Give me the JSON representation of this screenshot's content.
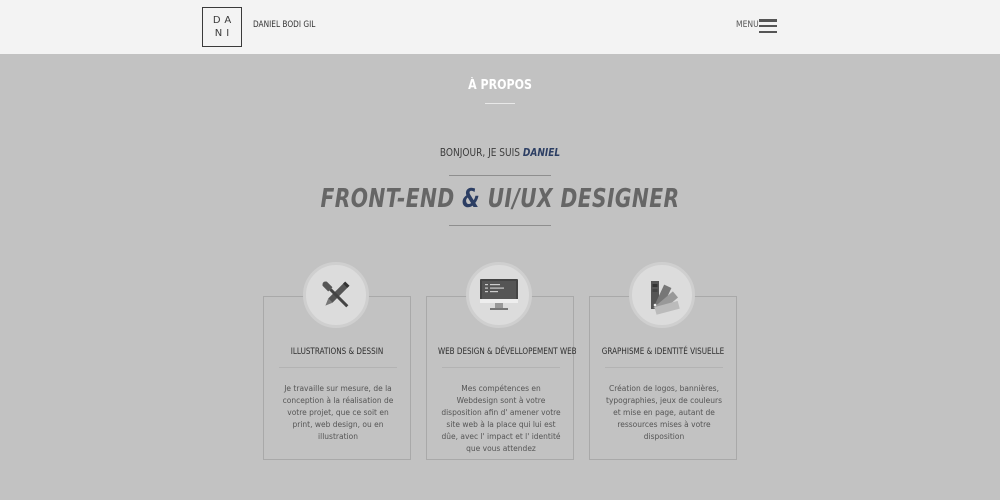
{
  "header": {
    "logo_line1": "DA",
    "logo_line2": "NI",
    "brand_name": "DANIEL BODI GIL",
    "menu_label": "MENU"
  },
  "about": {
    "section_title": "À PROPOS",
    "greeting": "BONJOUR, JE SUIS ",
    "greeting_name": "DANIEL",
    "headline_part1": "FRONT-END ",
    "headline_amp": "&",
    "headline_part2": " UI/UX DESIGNER"
  },
  "services": [
    {
      "icon": "brush-pencil-icon",
      "title": "ILLUSTRATIONS & DESSIN",
      "text": "Je travaille sur mesure, de la conception à la réalisation de votre projet, que ce soit en print, web design, ou en illustration"
    },
    {
      "icon": "monitor-code-icon",
      "title": "WEB DESIGN & DÉVELLOPEMENT WEB",
      "text": "Mes compétences en Webdesign sont à votre disposition afin d' amener votre site web à la place qui lui est dûe, avec l' impact et l' identité que vous attendez"
    },
    {
      "icon": "color-palette-icon",
      "title": "GRAPHISME & IDENTITÉ VISUELLE",
      "text": "Création de logos, bannières, typographies, jeux de couleurs et mise en page, autant de ressources mises à votre disposition"
    }
  ],
  "colors": {
    "background": "#c2c2c2",
    "header_bg": "#f3f3f3",
    "accent": "#2c3e63"
  }
}
